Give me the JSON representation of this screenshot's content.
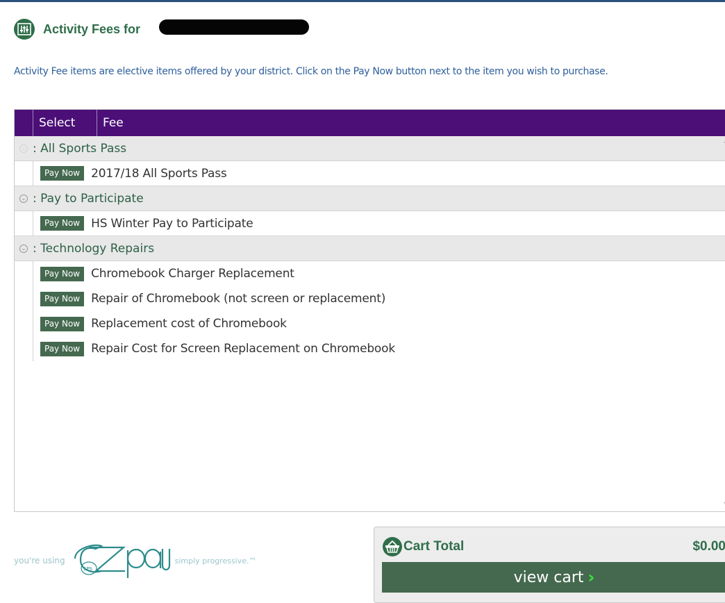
{
  "header": {
    "title": "Activity Fees for",
    "icon": "activity-fees-icon"
  },
  "intro_text": "Activity Fee items are elective items offered by your district. Click on the Pay Now button next to the item you wish to purchase.",
  "grid": {
    "columns": {
      "select": "Select",
      "fee": "Fee"
    },
    "groups": [
      {
        "label": ": All Sports Pass",
        "items": [
          {
            "button": "Pay Now",
            "name": "2017/18 All Sports Pass"
          }
        ]
      },
      {
        "label": ": Pay to Participate",
        "items": [
          {
            "button": "Pay Now",
            "name": "HS Winter Pay to Participate"
          }
        ]
      },
      {
        "label": ": Technology Repairs",
        "items": [
          {
            "button": "Pay Now",
            "name": "Chromebook Charger Replacement"
          },
          {
            "button": "Pay Now",
            "name": "Repair of Chromebook (not screen or replacement)"
          },
          {
            "button": "Pay Now",
            "name": "Replacement cost of Chromebook"
          },
          {
            "button": "Pay Now",
            "name": "Repair Cost for Screen Replacement on Chromebook"
          }
        ]
      }
    ]
  },
  "footer": {
    "tagline_left": "you're using",
    "logo_text": "ezpay",
    "logo_sub": "SPS",
    "tagline_right": "simply progressive.™"
  },
  "cart": {
    "title": "Cart Total",
    "amount": "$0.00",
    "view_cart_label": "view cart",
    "icon": "cart-basket-icon"
  },
  "colors": {
    "brand_green": "#2f6e4a",
    "header_purple": "#4b0f77",
    "button_green": "#45694f",
    "link_blue": "#2e5f9b"
  }
}
